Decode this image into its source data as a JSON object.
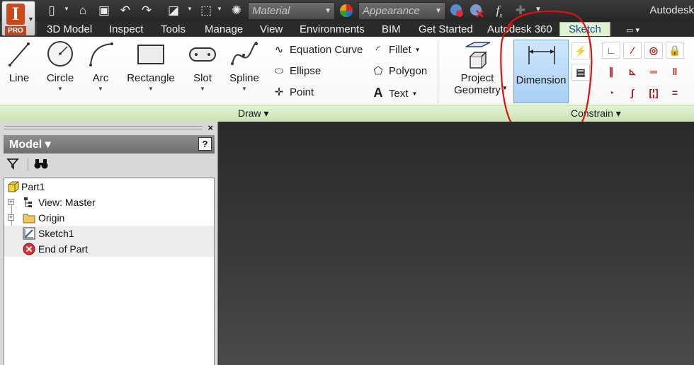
{
  "app": {
    "title": "Autodesk",
    "logo_letter": "I",
    "edition": "PRO"
  },
  "qat": {
    "material_placeholder": "Material",
    "appearance_placeholder": "Appearance",
    "fx_label": "f",
    "fx_sub": "x"
  },
  "tabs": [
    "3D Model",
    "Inspect",
    "Tools",
    "Manage",
    "View",
    "Environments",
    "BIM",
    "Get Started",
    "Autodesk 360",
    "Sketch"
  ],
  "active_tab": "Sketch",
  "draw_panel": {
    "title": "Draw",
    "big_tools": [
      "Line",
      "Circle",
      "Arc",
      "Rectangle",
      "Slot",
      "Spline"
    ],
    "small_tools": [
      "Equation Curve",
      "Ellipse",
      "Point",
      "Fillet",
      "Polygon",
      "Text"
    ]
  },
  "project_geometry": {
    "line1": "Project",
    "line2": "Geometry"
  },
  "constrain_panel": {
    "title": "Constrain",
    "dimension_label": "Dimension"
  },
  "browser": {
    "title": "Model",
    "help": "?",
    "close": "×",
    "tree": [
      {
        "label": "Part1"
      },
      {
        "label": "View: Master"
      },
      {
        "label": "Origin"
      },
      {
        "label": "Sketch1"
      },
      {
        "label": "End of Part"
      }
    ]
  },
  "colors": {
    "ribbon_panel_bar": "#c9e3b3",
    "active_tab_bg": "#dff1d2",
    "dimension_highlight": "#a8d0f4",
    "annotation_red": "#e01010",
    "logo_orange": "#c84a1d"
  }
}
